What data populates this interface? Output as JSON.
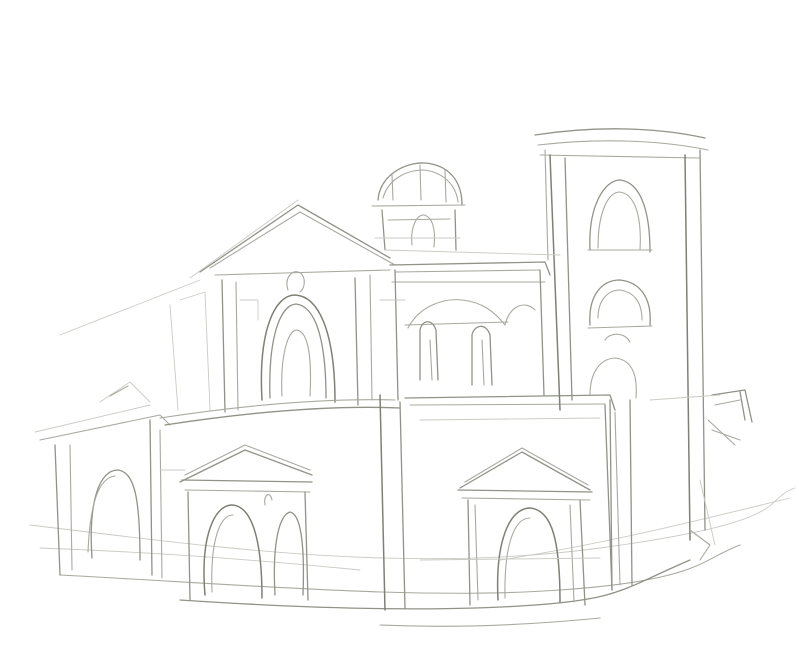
{
  "canvas": {
    "background": "#ffffff",
    "stroke_colors": [
      "#7d8176",
      "#8f9388",
      "#a7aaa0",
      "#c9cbc4"
    ]
  }
}
